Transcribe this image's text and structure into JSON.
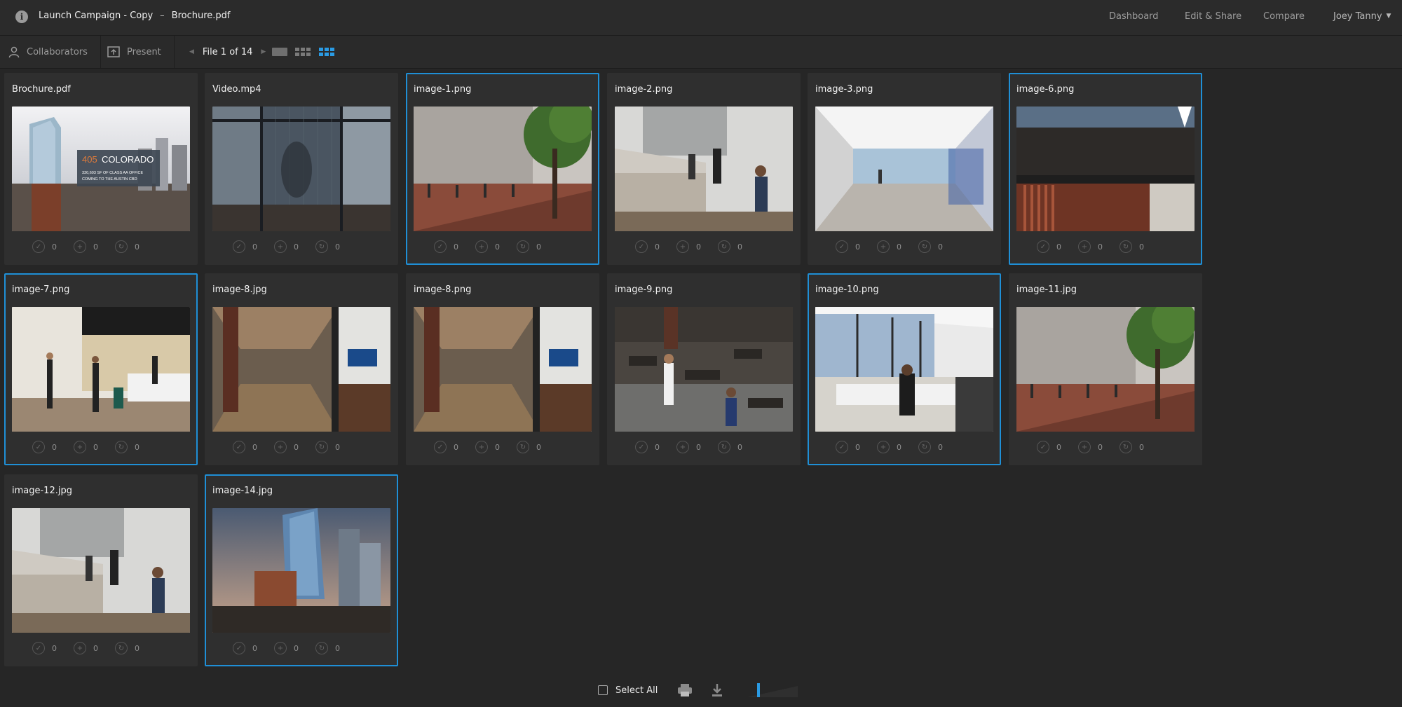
{
  "header": {
    "project": "Launch Campaign - Copy",
    "separator": "–",
    "file": "Brochure.pdf",
    "nav": [
      "Dashboard",
      "Edit & Share",
      "Compare"
    ],
    "user": "Joey Tanny"
  },
  "toolbar": {
    "collaborators_label": "Collaborators",
    "present_label": "Present",
    "file_position": "File 1 of 14",
    "view_modes": [
      "list",
      "medium-grid",
      "large-grid"
    ],
    "active_view": "large-grid"
  },
  "accent_color": "#1f8fd6",
  "files": [
    {
      "name": "Brochure.pdf",
      "selected": false,
      "approvals": "0",
      "comments": "0",
      "versions": "0"
    },
    {
      "name": "Video.mp4",
      "selected": false,
      "approvals": "0",
      "comments": "0",
      "versions": "0"
    },
    {
      "name": "image-1.png",
      "selected": true,
      "approvals": "0",
      "comments": "0",
      "versions": "0"
    },
    {
      "name": "image-2.png",
      "selected": false,
      "approvals": "0",
      "comments": "0",
      "versions": "0"
    },
    {
      "name": "image-3.png",
      "selected": false,
      "approvals": "0",
      "comments": "0",
      "versions": "0"
    },
    {
      "name": "image-6.png",
      "selected": true,
      "approvals": "0",
      "comments": "0",
      "versions": "0"
    },
    {
      "name": "image-7.png",
      "selected": true,
      "approvals": "0",
      "comments": "0",
      "versions": "0"
    },
    {
      "name": "image-8.jpg",
      "selected": false,
      "approvals": "0",
      "comments": "0",
      "versions": "0"
    },
    {
      "name": "image-8.png",
      "selected": false,
      "approvals": "0",
      "comments": "0",
      "versions": "0"
    },
    {
      "name": "image-9.png",
      "selected": false,
      "approvals": "0",
      "comments": "0",
      "versions": "0"
    },
    {
      "name": "image-10.png",
      "selected": true,
      "approvals": "0",
      "comments": "0",
      "versions": "0"
    },
    {
      "name": "image-11.jpg",
      "selected": false,
      "approvals": "0",
      "comments": "0",
      "versions": "0"
    },
    {
      "name": "image-12.jpg",
      "selected": false,
      "approvals": "0",
      "comments": "0",
      "versions": "0"
    },
    {
      "name": "image-14.jpg",
      "selected": true,
      "approvals": "0",
      "comments": "0",
      "versions": "0"
    }
  ],
  "brochure_thumb": {
    "number": "405",
    "name": "COLORADO",
    "line1": "330,603 SF OF CLASS AA OFFICE",
    "line2": "COMING TO THE AUSTIN CBD"
  },
  "footer": {
    "select_all_label": "Select All",
    "zoom_level": 0.2
  }
}
